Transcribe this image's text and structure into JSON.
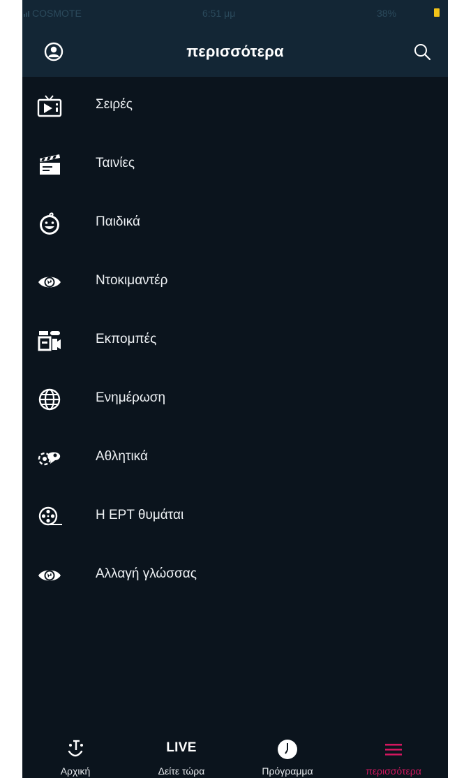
{
  "status_bar": {
    "carrier": "COSMOTE",
    "time": "6:51 μμ",
    "battery": "38%",
    "battery_color": "#f2c318"
  },
  "header": {
    "title": "περισσότερα",
    "profile_icon": "user-circle-icon",
    "search_icon": "search-icon"
  },
  "menu": {
    "items": [
      {
        "label": "Σειρές",
        "icon": "tv-icon"
      },
      {
        "label": "Ταινίες",
        "icon": "clapperboard-icon"
      },
      {
        "label": "Παιδικά",
        "icon": "kid-face-icon"
      },
      {
        "label": "Ντοκιμαντέρ",
        "icon": "eye-icon"
      },
      {
        "label": "Εκπομπές",
        "icon": "studio-icon"
      },
      {
        "label": "Ενημέρωση",
        "icon": "globe-icon"
      },
      {
        "label": "Αθλητικά",
        "icon": "sports-icon"
      },
      {
        "label": "Η ΕΡΤ θυμάται",
        "icon": "film-reel-icon"
      },
      {
        "label": "Αλλαγή γλώσσας",
        "icon": "eye-icon"
      }
    ]
  },
  "bottom_nav": {
    "items": [
      {
        "label": "Αρχική",
        "icon": "ert-logo-icon"
      },
      {
        "label": "Δείτε τώρα",
        "icon_text": "LIVE"
      },
      {
        "label": "Πρόγραμμα",
        "icon": "clock-icon"
      },
      {
        "label": "περισσότερα",
        "icon": "hamburger-menu-icon",
        "active": true
      }
    ],
    "active_color": "#d1175e"
  },
  "colors": {
    "background": "#0b141d",
    "header": "#132635",
    "text": "#eef1f4"
  }
}
